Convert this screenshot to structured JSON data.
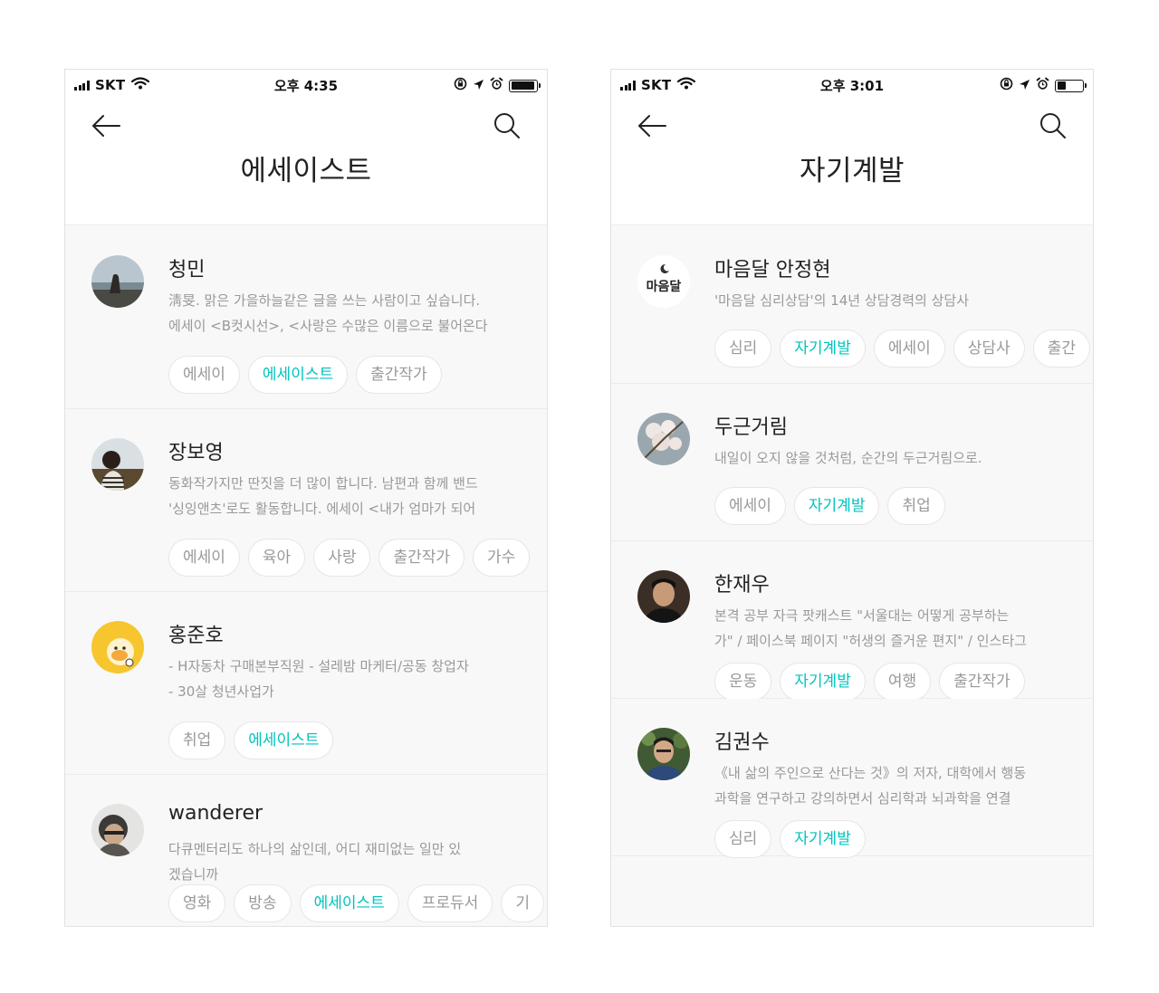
{
  "left_screen": {
    "status": {
      "carrier": "SKT",
      "time": "오후 4:35",
      "battery_level": 0.95
    },
    "title": "에세이스트",
    "authors": [
      {
        "name": "청민",
        "description": "淸旻. 맑은 가을하늘같은 글을 쓰는 사람이고 싶습니다.\n에세이 <B컷시선>, <사랑은 수많은 이름으로 불어온다",
        "tags": [
          "에세이",
          "에세이스트",
          "출간작가"
        ],
        "highlighted_tag": "에세이스트"
      },
      {
        "name": "장보영",
        "description": "동화작가지만 딴짓을 더 많이 합니다. 남편과 함께 밴드\n'싱잉앤츠'로도 활동합니다. 에세이 <내가 엄마가 되어",
        "tags": [
          "에세이",
          "육아",
          "사랑",
          "출간작가",
          "가수"
        ],
        "highlighted_tag": ""
      },
      {
        "name": "홍준호",
        "description": "- H자동차 구매본부직원 - 설레밤  마케터/공동 창업자\n- 30살 청년사업가",
        "tags": [
          "취업",
          "에세이스트"
        ],
        "highlighted_tag": "에세이스트"
      },
      {
        "name": "wanderer",
        "description": "다큐멘터리도 하나의 삶인데, 어디 재미없는 일만 있\n겠습니까",
        "tags": [
          "영화",
          "방송",
          "에세이스트",
          "프로듀서",
          "기"
        ],
        "highlighted_tag": "에세이스트"
      }
    ]
  },
  "right_screen": {
    "status": {
      "carrier": "SKT",
      "time": "오후 3:01",
      "battery_level": 0.35
    },
    "title": "자기계발",
    "authors": [
      {
        "name": "마음달 안정현",
        "avatar_text": "마음달",
        "description": "'마음달 심리상담'의 14년 상담경력의 상담사",
        "tags": [
          "심리",
          "자기계발",
          "에세이",
          "상담사",
          "출간"
        ],
        "highlighted_tag": "자기계발"
      },
      {
        "name": "두근거림",
        "description": "내일이 오지 않을 것처럼, 순간의 두근거림으로.",
        "tags": [
          "에세이",
          "자기계발",
          "취업"
        ],
        "highlighted_tag": "자기계발"
      },
      {
        "name": "한재우",
        "description": "본격 공부 자극 팟캐스트 \"서울대는 어떻게 공부하는\n가\" / 페이스북 페이지 \"허생의 즐거운 편지\" / 인스타그",
        "tags": [
          "운동",
          "자기계발",
          "여행",
          "출간작가"
        ],
        "highlighted_tag": "자기계발"
      },
      {
        "name": "김권수",
        "description": "《내 삶의 주인으로 산다는 것》의 저자,  대학에서 행동\n과학을 연구하고 강의하면서  심리학과 뇌과학을 연결",
        "tags": [
          "심리",
          "자기계발"
        ],
        "highlighted_tag": "자기계발"
      }
    ]
  }
}
